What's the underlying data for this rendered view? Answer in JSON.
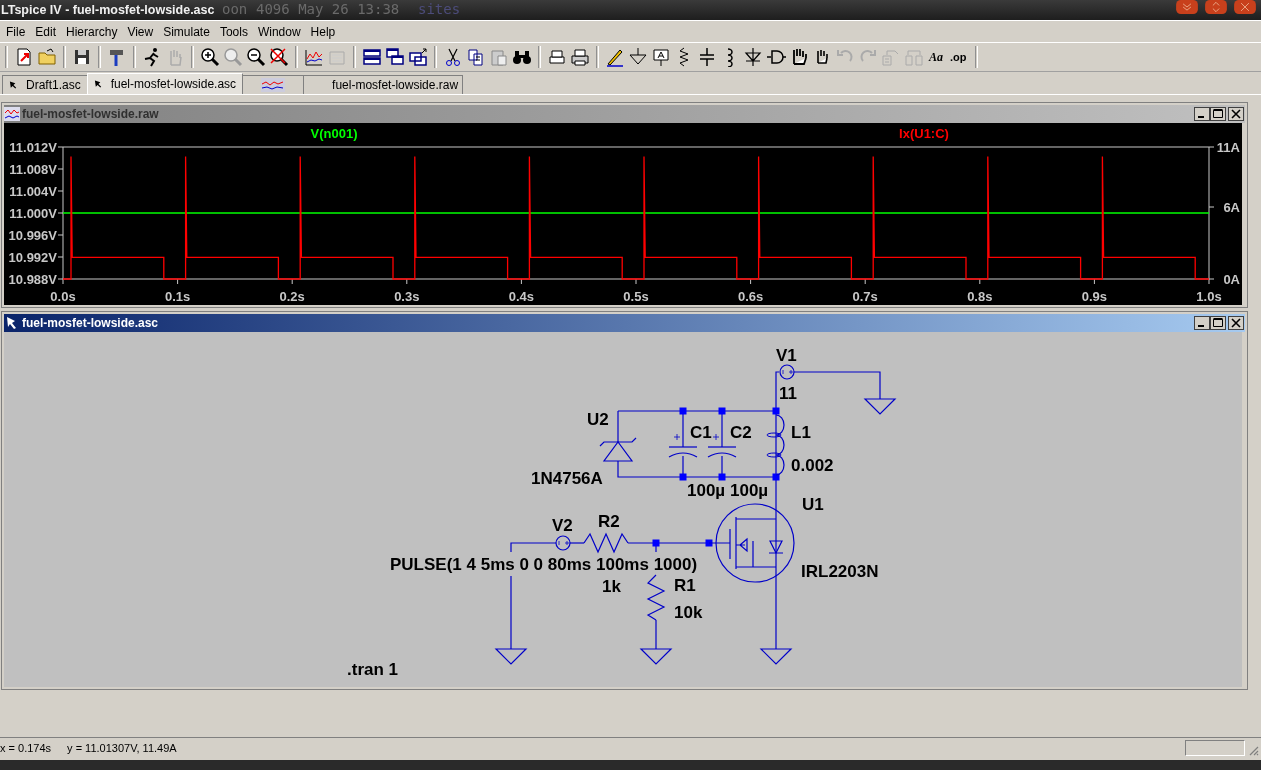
{
  "window": {
    "title": "LTspice IV - fuel-mosfet-lowside.asc",
    "backdrop_text": [
      "oon",
      "4096 May 26 13:38",
      "sites"
    ]
  },
  "menu": [
    "File",
    "Edit",
    "Hierarchy",
    "View",
    "Simulate",
    "Tools",
    "Window",
    "Help"
  ],
  "toolbar": {
    "text_buttons": [
      "Aa",
      ".op"
    ]
  },
  "tabs": [
    {
      "kind": "schematic",
      "label": "Draft1.asc",
      "selected": false
    },
    {
      "kind": "schematic",
      "label": "fuel-mosfet-lowside.asc",
      "selected": true
    },
    {
      "kind": "waveform",
      "selected": false
    },
    {
      "kind": "plain",
      "label": "fuel-mosfet-lowside.raw",
      "selected": false
    }
  ],
  "waveform_window": {
    "title": "fuel-mosfet-lowside.raw",
    "active": false,
    "chart_data": {
      "type": "line",
      "x": [
        0,
        0.007,
        0.007,
        0.008,
        0.088,
        0.088,
        0.107,
        0.107,
        0.108,
        0.188,
        0.188,
        0.207,
        0.207,
        0.208,
        0.288,
        0.288,
        0.307,
        0.307,
        0.308,
        0.388,
        0.388,
        0.407,
        0.407,
        0.408,
        0.488,
        0.488,
        0.507,
        0.507,
        0.508,
        0.588,
        0.588,
        0.607,
        0.607,
        0.608,
        0.688,
        0.688,
        0.707,
        0.707,
        0.708,
        0.788,
        0.788,
        0.807,
        0.807,
        0.808,
        0.888,
        0.888,
        0.907,
        0.907,
        0.908,
        0.988,
        0.988,
        1.0
      ],
      "series": [
        {
          "name": "V(n001)",
          "color": "#00ff00",
          "values": [
            11,
            11,
            11,
            11,
            11,
            11,
            11,
            11,
            11,
            11,
            11,
            11,
            11,
            11,
            11,
            11,
            11,
            11,
            11,
            11,
            11,
            11,
            11,
            11,
            11,
            11,
            11,
            11,
            11,
            11,
            11,
            11,
            11,
            11,
            11,
            11,
            11,
            11,
            11,
            11,
            11,
            11,
            11,
            11,
            11,
            11,
            11,
            11,
            11,
            11,
            11,
            11
          ]
        },
        {
          "name": "Ix(U1:C)",
          "color": "#ff0000",
          "axis": "y2",
          "values": [
            0,
            0,
            10.2,
            1.8,
            1.8,
            0,
            0,
            10.2,
            1.8,
            1.8,
            0,
            0,
            10.2,
            1.8,
            1.8,
            0,
            0,
            10.2,
            1.8,
            1.8,
            0,
            0,
            10.2,
            1.8,
            1.8,
            0,
            0,
            10.2,
            1.8,
            1.8,
            0,
            0,
            10.2,
            1.8,
            1.8,
            0,
            0,
            10.2,
            1.8,
            1.8,
            0,
            0,
            10.2,
            1.8,
            1.8,
            0,
            0,
            10.2,
            1.8,
            1.8,
            0,
            0
          ]
        }
      ],
      "xlim": [
        0,
        1
      ],
      "ylim": [
        10.988,
        11.012
      ],
      "y2lim": [
        0,
        11
      ],
      "xticks": [
        {
          "value": 0,
          "label": "0.0s"
        },
        {
          "value": 0.1,
          "label": "0.1s"
        },
        {
          "value": 0.2,
          "label": "0.2s"
        },
        {
          "value": 0.3,
          "label": "0.3s"
        },
        {
          "value": 0.4,
          "label": "0.4s"
        },
        {
          "value": 0.5,
          "label": "0.5s"
        },
        {
          "value": 0.6,
          "label": "0.6s"
        },
        {
          "value": 0.7,
          "label": "0.7s"
        },
        {
          "value": 0.8,
          "label": "0.8s"
        },
        {
          "value": 0.9,
          "label": "0.9s"
        },
        {
          "value": 1,
          "label": "1.0s"
        }
      ],
      "yticks": [
        {
          "value": 11.012,
          "label": "11.012V"
        },
        {
          "value": 11.008,
          "label": "11.008V"
        },
        {
          "value": 11.004,
          "label": "11.004V"
        },
        {
          "value": 11.0,
          "label": "11.000V"
        },
        {
          "value": 10.996,
          "label": "10.996V"
        },
        {
          "value": 10.992,
          "label": "10.992V"
        },
        {
          "value": 10.988,
          "label": "10.988V"
        }
      ],
      "y2ticks": [
        {
          "value": 11,
          "label": "11A"
        },
        {
          "value": 6,
          "label": "6A"
        },
        {
          "value": 0,
          "label": "0A"
        }
      ]
    }
  },
  "schematic_window": {
    "title": "fuel-mosfet-lowside.asc",
    "active": true,
    "components": [
      {
        "kind": "voltage_source",
        "ref": "V1",
        "value": "11"
      },
      {
        "kind": "zener",
        "ref": "U2",
        "value": "1N4756A"
      },
      {
        "kind": "polarized_capacitor",
        "ref": "C1",
        "value": "100µ"
      },
      {
        "kind": "polarized_capacitor",
        "ref": "C2",
        "value": "100µ"
      },
      {
        "kind": "inductor",
        "ref": "L1",
        "value": "0.002"
      },
      {
        "kind": "voltage_source",
        "ref": "V2",
        "value": "PULSE(1 4 5ms 0 0 80ms 100ms 1000)"
      },
      {
        "kind": "resistor",
        "ref": "R2",
        "value": "1k"
      },
      {
        "kind": "resistor_vertical",
        "ref": "R1",
        "value": "10k"
      },
      {
        "kind": "nmos",
        "ref": "U1",
        "value": "IRL2203N"
      }
    ],
    "directive": ".tran 1"
  },
  "status_bar": [
    "x = 0.174s",
    "y = 11.01307V, 11.49A"
  ]
}
